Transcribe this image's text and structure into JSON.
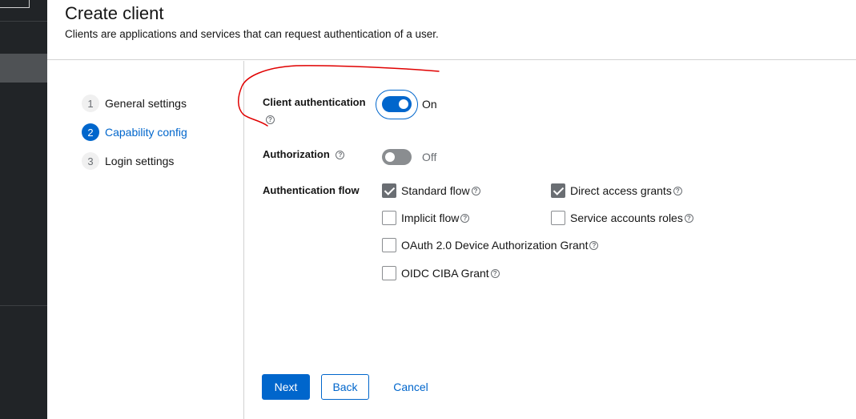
{
  "header": {
    "title": "Create client",
    "description": "Clients are applications and services that can request authentication of a user."
  },
  "wizard": {
    "steps": [
      {
        "number": "1",
        "label": "General settings",
        "current": false
      },
      {
        "number": "2",
        "label": "Capability config",
        "current": true
      },
      {
        "number": "3",
        "label": "Login settings",
        "current": false
      }
    ]
  },
  "form": {
    "client_authentication": {
      "label": "Client authentication",
      "state_text": "On",
      "enabled": true
    },
    "authorization": {
      "label": "Authorization",
      "state_text": "Off",
      "enabled": false
    },
    "authentication_flow": {
      "label": "Authentication flow",
      "options": [
        {
          "label": "Standard flow",
          "checked": true
        },
        {
          "label": "Direct access grants",
          "checked": true
        },
        {
          "label": "Implicit flow",
          "checked": false
        },
        {
          "label": "Service accounts roles",
          "checked": false
        },
        {
          "label": "OAuth 2.0 Device Authorization Grant",
          "checked": false
        },
        {
          "label": "OIDC CIBA Grant",
          "checked": false
        }
      ]
    }
  },
  "actions": {
    "next_label": "Next",
    "back_label": "Back",
    "cancel_label": "Cancel"
  },
  "help_glyph": "?",
  "colors": {
    "primary": "#0066cc",
    "sidebar": "#212427",
    "annotation": "#e00000"
  }
}
